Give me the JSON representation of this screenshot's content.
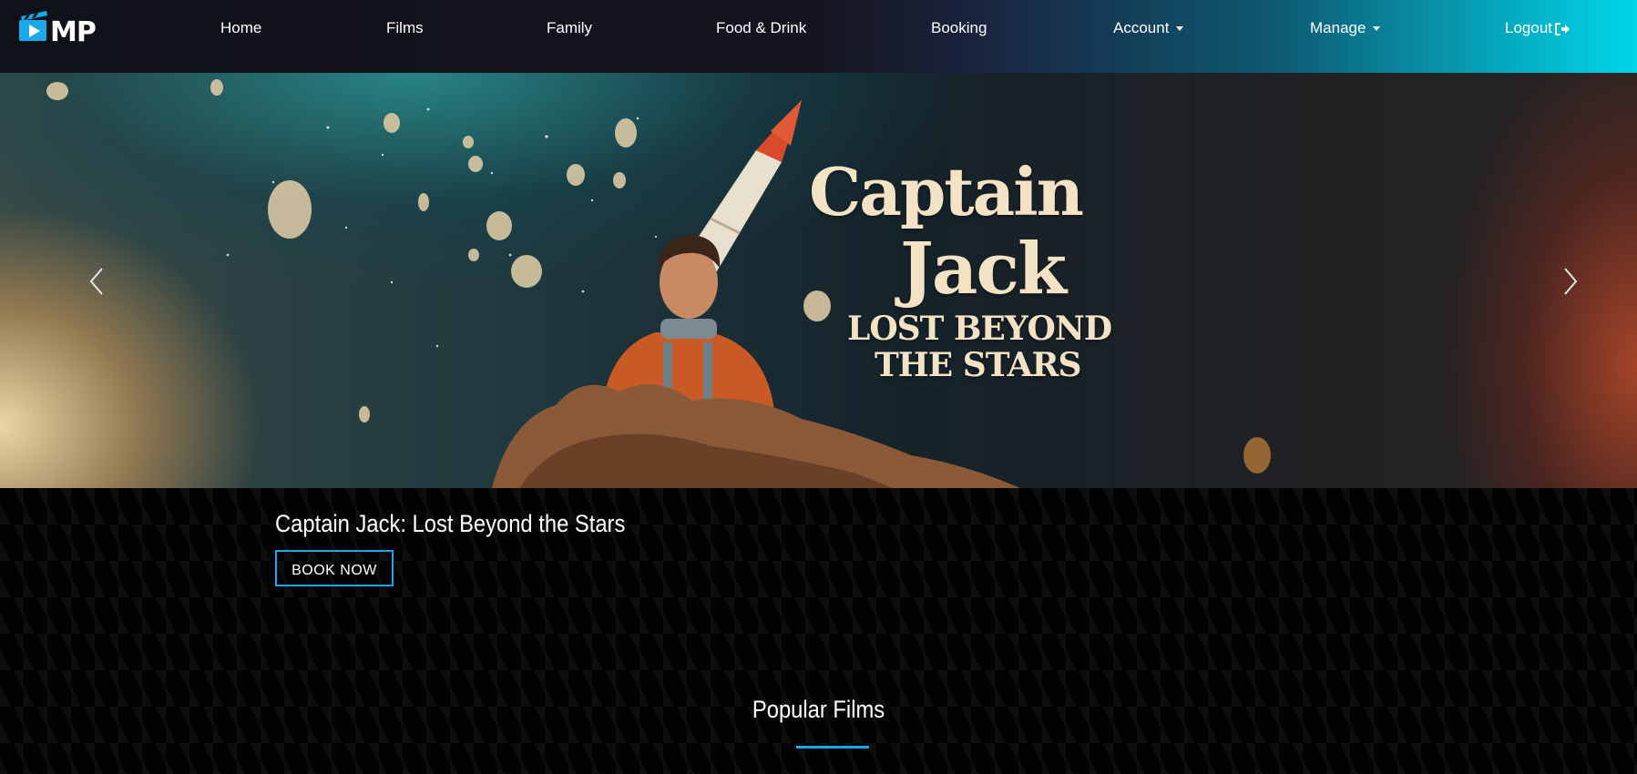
{
  "brand": {
    "logo_text": "MP",
    "icon": "clapperboard-play-icon"
  },
  "nav": {
    "items": [
      {
        "label": "Home"
      },
      {
        "label": "Films"
      },
      {
        "label": "Family"
      },
      {
        "label": "Food & Drink"
      },
      {
        "label": "Booking"
      },
      {
        "label": "Account",
        "dropdown": true
      },
      {
        "label": "Manage",
        "dropdown": true
      },
      {
        "label": "Logout",
        "icon": "logout-icon"
      }
    ]
  },
  "hero": {
    "poster_title_line1": "Captain",
    "poster_title_line2": "Jack",
    "poster_subtitle_line1": "LOST BEYOND",
    "poster_subtitle_line2": "THE STARS",
    "prev_icon": "chevron-left-icon",
    "next_icon": "chevron-right-icon"
  },
  "featured": {
    "title": "Captain Jack: Lost Beyond the Stars",
    "button_label": "BOOK NOW"
  },
  "popular": {
    "heading": "Popular Films"
  },
  "colors": {
    "accent": "#1ea5ec",
    "nav_gradient_end": "#00d6ea",
    "background": "#030303",
    "poster_text": "#f3e3c4"
  }
}
